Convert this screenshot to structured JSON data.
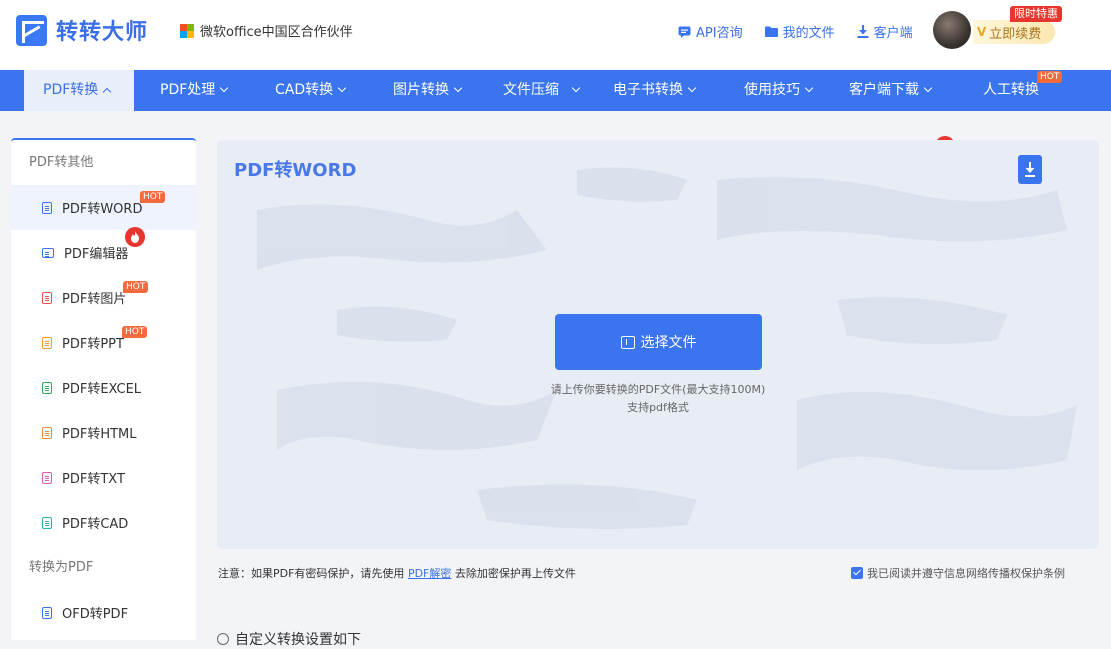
{
  "brand": {
    "name": "转转大师",
    "partner": "微软office中国区合作伙伴"
  },
  "header": {
    "links": [
      {
        "label": "API咨询",
        "icon": "chat-icon"
      },
      {
        "label": "我的文件",
        "icon": "folder-icon"
      },
      {
        "label": "客户端",
        "icon": "download-icon"
      }
    ],
    "promo_badge": "限时特惠",
    "renew_label": "立即续费",
    "vip_mark": "V"
  },
  "nav": {
    "items": [
      {
        "label": "PDF转换"
      },
      {
        "label": "PDF处理"
      },
      {
        "label": "CAD转换"
      },
      {
        "label": "图片转换"
      },
      {
        "label": "文件压缩"
      },
      {
        "label": "电子书转换"
      },
      {
        "label": "使用技巧"
      },
      {
        "label": "客户端下载"
      },
      {
        "label": "人工转换"
      }
    ],
    "hot_label": "HOT"
  },
  "sidebar": {
    "group1": "PDF转其他",
    "items": [
      {
        "label": "PDF转WORD",
        "icon_color": "#3a74ee"
      },
      {
        "label": "PDF编辑器",
        "icon_color": "#3a74ee"
      },
      {
        "label": "PDF转图片",
        "icon_color": "#e8504a"
      },
      {
        "label": "PDF转PPT",
        "icon_color": "#f29b2c"
      },
      {
        "label": "PDF转EXCEL",
        "icon_color": "#2fae5b"
      },
      {
        "label": "PDF转HTML",
        "icon_color": "#f08a3e"
      },
      {
        "label": "PDF转TXT",
        "icon_color": "#e35bb0"
      },
      {
        "label": "PDF转CAD",
        "icon_color": "#2bb3a5"
      }
    ],
    "group2": "转换为PDF",
    "items2": [
      {
        "label": "OFD转PDF",
        "icon_color": "#3a74ee"
      }
    ],
    "hot_label": "HOT"
  },
  "main": {
    "title": "PDF转WORD",
    "select_button": "选择文件",
    "hint1": "请上传你要转换的PDF文件(最大支持100M)",
    "hint2": "支持pdf格式"
  },
  "footer": {
    "note_prefix": "注意：如果PDF有密码保护，请先使用",
    "note_link": "PDF解密",
    "note_suffix": "去除加密保护再上传文件",
    "agree_text": "我已阅读并遵守信息网络传播权保护条例",
    "agree_checked": true,
    "settings_label": "自定义转换设置如下"
  },
  "colors": {
    "brand_blue": "#3a74ee",
    "hot": "#f46a3c",
    "fire": "#e8352e",
    "panel_bg": "#e7ecf5"
  }
}
